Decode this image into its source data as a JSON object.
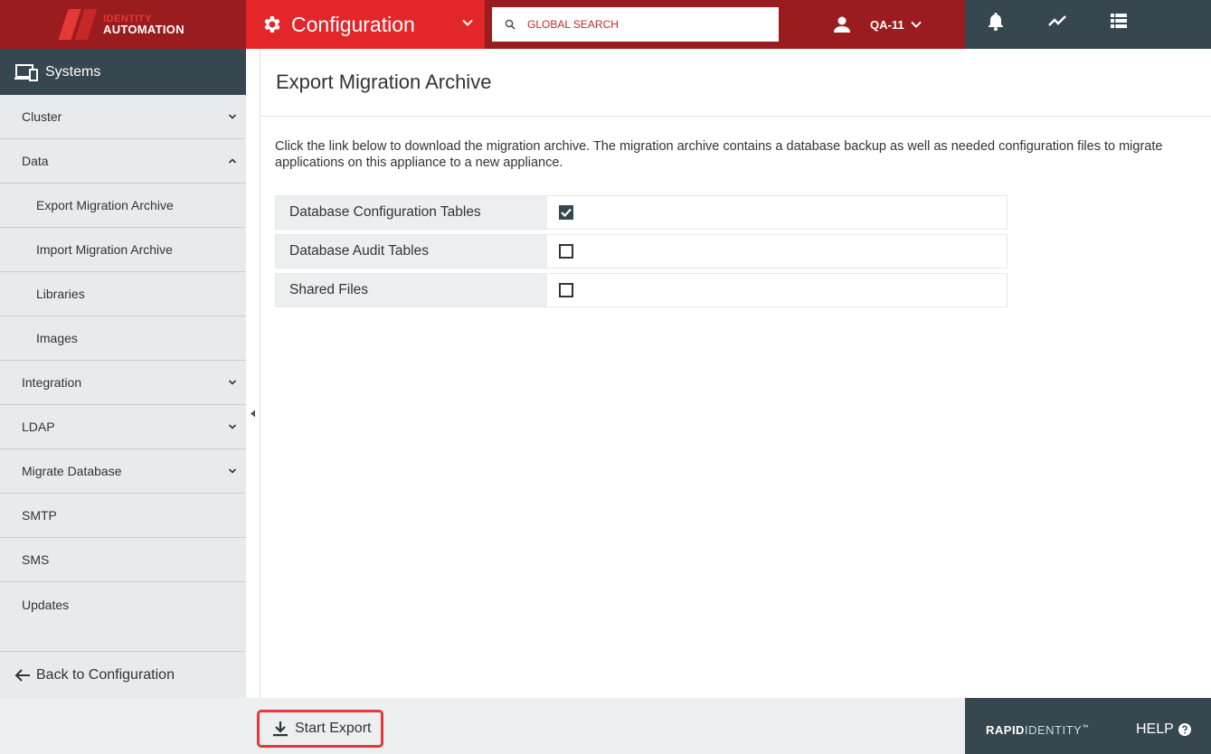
{
  "header": {
    "logo_line1": "IDENTITY",
    "logo_line2": "AUTOMATION",
    "module_title": "Configuration",
    "search_placeholder": "GLOBAL SEARCH",
    "username": "QA-11"
  },
  "sidebar": {
    "heading": "Systems",
    "items": [
      {
        "label": "Cluster",
        "expandable": true
      },
      {
        "label": "Data",
        "expandable": true,
        "expanded": true
      },
      {
        "label": "Export Migration Archive",
        "sub": true
      },
      {
        "label": "Import Migration Archive",
        "sub": true
      },
      {
        "label": "Libraries",
        "sub": true
      },
      {
        "label": "Images",
        "sub": true
      },
      {
        "label": "Integration",
        "expandable": true
      },
      {
        "label": "LDAP",
        "expandable": true
      },
      {
        "label": "Migrate Database",
        "expandable": true
      },
      {
        "label": "SMTP"
      },
      {
        "label": "SMS"
      },
      {
        "label": "Updates"
      }
    ],
    "back_label": "Back to Configuration"
  },
  "main": {
    "title": "Export Migration Archive",
    "description": "Click the link below to download the migration archive. The migration archive contains a database backup as well as needed configuration files to migrate applications on this appliance to a new appliance.",
    "options": [
      {
        "label": "Database Configuration Tables",
        "checked": true
      },
      {
        "label": "Database Audit Tables",
        "checked": false
      },
      {
        "label": "Shared Files",
        "checked": false
      }
    ]
  },
  "footer": {
    "start_export_label": "Start Export",
    "brand_bold": "RAPID",
    "brand_light": "IDENTITY",
    "brand_tm": "™",
    "help_label": "HELP"
  },
  "colors": {
    "topbar_dark_red": "#9b1c1f",
    "module_red": "#e3262a",
    "slate": "#37474f",
    "highlight_red": "#e53935"
  }
}
